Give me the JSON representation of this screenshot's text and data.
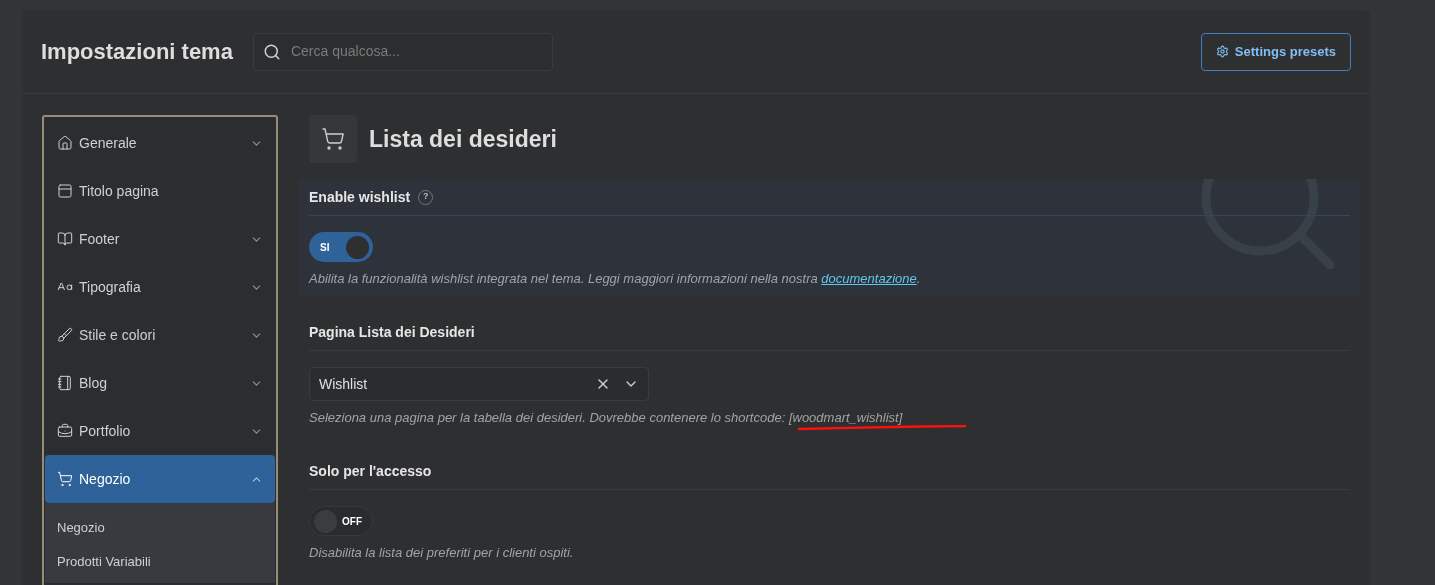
{
  "header": {
    "title": "Impostazioni tema",
    "search": {
      "placeholder": "Cerca qualcosa..."
    },
    "presets_button": "Settings presets"
  },
  "sidebar": {
    "items": [
      {
        "label": "Generale",
        "kind": "group",
        "selected": false,
        "expanded": false
      },
      {
        "label": "Titolo pagina",
        "kind": "link",
        "selected": false
      },
      {
        "label": "Footer",
        "kind": "group",
        "selected": false,
        "expanded": false
      },
      {
        "label": "Tipografia",
        "kind": "group",
        "selected": false,
        "expanded": false
      },
      {
        "label": "Stile e colori",
        "kind": "group",
        "selected": false,
        "expanded": false
      },
      {
        "label": "Blog",
        "kind": "group",
        "selected": false,
        "expanded": false
      },
      {
        "label": "Portfolio",
        "kind": "group",
        "selected": false,
        "expanded": false
      },
      {
        "label": "Negozio",
        "kind": "group",
        "selected": true,
        "expanded": true,
        "children": [
          {
            "label": "Negozio"
          },
          {
            "label": "Prodotti Variabili"
          }
        ]
      }
    ]
  },
  "page": {
    "title": "Lista dei desideri",
    "sections": [
      {
        "kind": "toggle",
        "label": "Enable wishlist",
        "help": "?",
        "highlighted": true,
        "toggle": {
          "on": true,
          "label": "SI"
        },
        "description": "Abilita la funzionalità wishlist integrata nel tema. Leggi maggiori informazioni nella nostra ",
        "link": "documentazione",
        "description_end": "."
      },
      {
        "kind": "select",
        "label": "Pagina Lista dei Desideri",
        "value": "Wishlist",
        "description": "Seleziona una pagina per la tabella dei desideri. Dovrebbe contenere lo shortcode: [woodmart_wishlist]"
      },
      {
        "kind": "toggle",
        "label": "Solo per l'accesso",
        "highlighted": false,
        "toggle": {
          "on": false,
          "label": "OFF"
        },
        "description": "Disabilita la lista dei preferiti per i clienti ospiti."
      }
    ]
  }
}
